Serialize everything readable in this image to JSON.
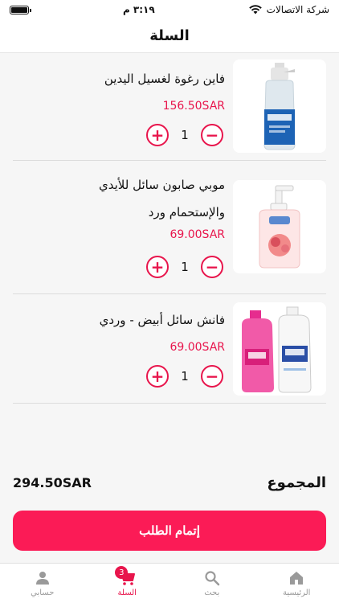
{
  "status_bar": {
    "carrier": "شركة الاتصالات",
    "time": "٣:١٩ م"
  },
  "header": {
    "title": "السلة"
  },
  "cart": {
    "items": [
      {
        "name_line1": "فاين رغوة لغسيل اليدين",
        "name_line2": "",
        "price": "156.50SAR",
        "quantity": "1",
        "image_icon": "foam-hand-wash-bottle-icon"
      },
      {
        "name_line1": "موبي صابون سائل للأيدي",
        "name_line2": "والإستحمام ورد",
        "price": "69.00SAR",
        "quantity": "1",
        "image_icon": "liquid-hand-soap-pump-icon"
      },
      {
        "name_line1": "فانش سائل أبيض - وردي",
        "name_line2": "",
        "price": "69.00SAR",
        "quantity": "1",
        "image_icon": "vanish-bottles-icon"
      }
    ]
  },
  "summary": {
    "total_label": "المجموع",
    "total_amount": "294.50SAR"
  },
  "checkout": {
    "label": "إتمام الطلب"
  },
  "tab_bar": {
    "items": [
      {
        "label": "حسابي",
        "icon": "person-icon"
      },
      {
        "label": "السلة",
        "icon": "cart-icon",
        "badge": "3"
      },
      {
        "label": "بحث",
        "icon": "search-icon"
      },
      {
        "label": "الرئيسية",
        "icon": "home-icon"
      }
    ]
  },
  "colors": {
    "accent": "#e8154c",
    "button": "#fb1b56",
    "background": "#f6f6f6"
  }
}
